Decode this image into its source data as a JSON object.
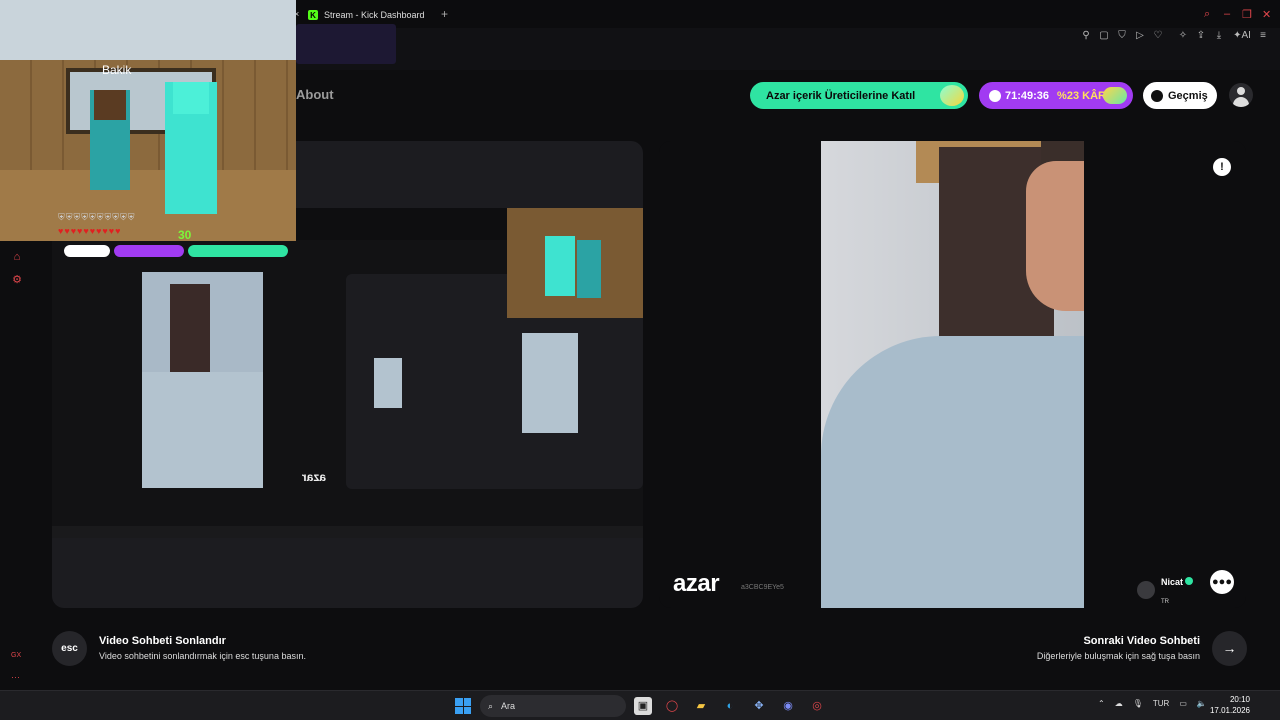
{
  "browser": {
    "tab_title": "Stream - Kick Dashboard",
    "tab_close": "×",
    "new_tab": "+"
  },
  "header": {
    "about": "About",
    "join_button": "Azar içerik Üreticilerine Katıl",
    "timer": "71:49:36",
    "profit": "%23 KÂR",
    "history_button": "Geçmiş"
  },
  "minecraft": {
    "player_tag": "Bakik",
    "level": "30"
  },
  "video": {
    "brand": "azar",
    "session_id": "a3CBC9EYe5",
    "peer_name": "Nicat",
    "peer_country": "TR"
  },
  "footer": {
    "esc_label": "esc",
    "end_title": "Video Sohbeti Sonlandır",
    "end_desc": "Video sohbetini sonlandırmak için esc tuşuna basın.",
    "next_title": "Sonraki Video Sohbeti",
    "next_desc": "Diğerleriyle buluşmak için sağ tuşa basın",
    "gx_label": "GX"
  },
  "taskbar": {
    "search_placeholder": "Ara",
    "language": "TUR",
    "time": "20:10",
    "date": "17.01.2026"
  },
  "colors": {
    "join_bg": "#2fe4a2",
    "timer_bg": "#a13bf2",
    "accent_red": "#e0464b"
  }
}
